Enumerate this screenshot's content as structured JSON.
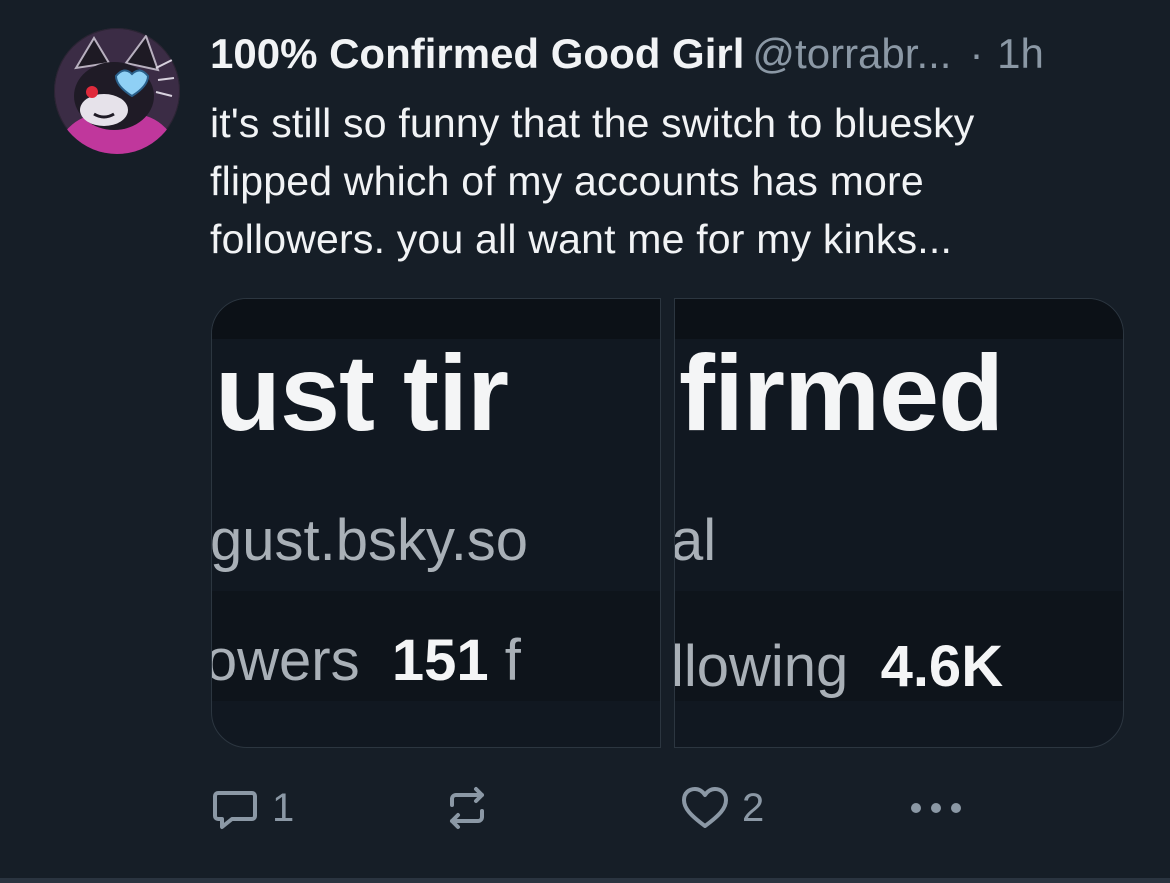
{
  "post": {
    "author": {
      "display_name": "100% Confirmed Good Girl",
      "handle": "@torrabr...",
      "separator": "·",
      "time": "1h"
    },
    "text": "it's still so funny that the switch to bluesky\nflipped  which of my accounts has more\nfollowers. you all want me for my kinks...",
    "images": [
      {
        "name_fragment": "just tir",
        "handle_fragment": "gust.bsky.so",
        "stats_label": "lowers",
        "stats_value": "151",
        "stats_tail": "f"
      },
      {
        "name_fragment": "firmed",
        "handle_fragment": "al",
        "stats_label": "llowing",
        "stats_value": "4.6K"
      }
    ],
    "actions": {
      "reply_icon": "reply-icon",
      "reply_count": "1",
      "repost_icon": "repost-icon",
      "like_icon": "heart-icon",
      "like_count": "2",
      "more_icon": "more-options-icon"
    }
  },
  "colors": {
    "background": "#161e27",
    "text_primary": "#f1f3f5",
    "text_secondary": "#8b98a5",
    "border": "#2c3640"
  }
}
